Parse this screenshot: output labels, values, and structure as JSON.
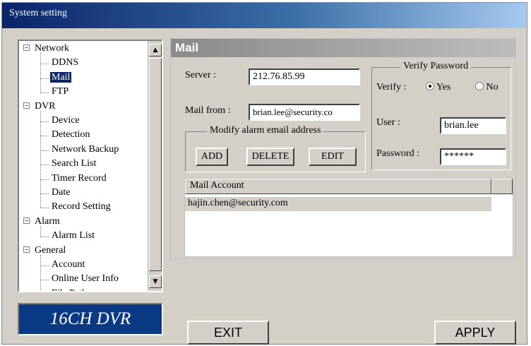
{
  "window": {
    "title": "System setting"
  },
  "tree": {
    "items": [
      {
        "label": "Network",
        "level": 0,
        "expanded": true
      },
      {
        "label": "DDNS",
        "level": 1
      },
      {
        "label": "Mail",
        "level": 1,
        "selected": true
      },
      {
        "label": "FTP",
        "level": 1
      },
      {
        "label": "DVR",
        "level": 0,
        "expanded": true
      },
      {
        "label": "Device",
        "level": 1
      },
      {
        "label": "Detection",
        "level": 1
      },
      {
        "label": "Network Backup",
        "level": 1
      },
      {
        "label": "Search List",
        "level": 1
      },
      {
        "label": "Timer Record",
        "level": 1
      },
      {
        "label": "Date",
        "level": 1
      },
      {
        "label": "Record Setting",
        "level": 1
      },
      {
        "label": "Alarm",
        "level": 0,
        "expanded": true
      },
      {
        "label": "Alarm List",
        "level": 1
      },
      {
        "label": "General",
        "level": 0,
        "expanded": true
      },
      {
        "label": "Account",
        "level": 1
      },
      {
        "label": "Online User Info",
        "level": 1
      },
      {
        "label": "File Path",
        "level": 1
      }
    ]
  },
  "logo": {
    "text": "16CH DVR"
  },
  "mail": {
    "title": "Mail",
    "server_label": "Server :",
    "server_value": "212.76.85.99",
    "mail_from_label": "Mail from :",
    "mail_from_value": "brian.lee@security.co",
    "modify_group_title": "Modify alarm email address",
    "add_label": "ADD",
    "delete_label": "DELETE",
    "edit_label": "EDIT"
  },
  "verify": {
    "group_title": "Verify Password",
    "verify_label": "Verify :",
    "yes_label": "Yes",
    "no_label": "No",
    "selected": "Yes",
    "user_label": "User :",
    "user_value": "brian.lee",
    "password_label": "Password :",
    "password_value": "******"
  },
  "mail_list": {
    "column_header": "Mail Account",
    "rows": [
      "hajin.chen@security.com"
    ]
  },
  "buttons": {
    "exit_label": "EXIT",
    "apply_label": "APPLY"
  }
}
